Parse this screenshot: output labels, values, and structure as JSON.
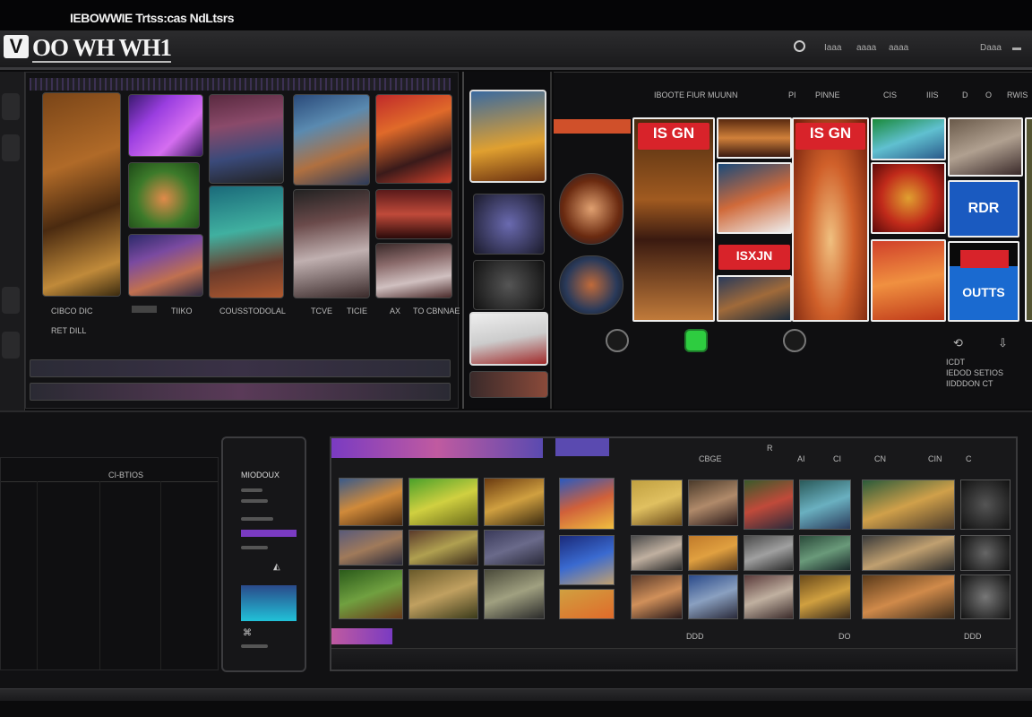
{
  "window": {
    "title": "IEBOWWIE Trtss:cas NdLtsrs"
  },
  "header": {
    "logo_badge": "V",
    "logo_text": "OO WH WH1",
    "nav": [
      "Iaaa",
      "aaaa",
      "aaaa",
      "Daaa"
    ]
  },
  "gallery": {
    "labels": [
      "CIBCO DIC",
      "TIIKO",
      "COUSSTODOLAL",
      "TCVE",
      "TICIE",
      "AX",
      "TO CBNNAE"
    ],
    "sub_label": "RET DILL"
  },
  "right_panel": {
    "top_label": "IBOOTE FIUR MUUNN",
    "top_items": [
      "PI",
      "PINNE",
      "CIS",
      "IIIS",
      "D",
      "O",
      "RWIS"
    ],
    "cards": [
      "IS GN",
      "IS GN",
      "ISXJN",
      "RDR",
      "OUTTS"
    ],
    "info_lines": [
      "ICDT",
      "IEDOD SETIOS",
      "IIDDDON CT"
    ]
  },
  "lower": {
    "side_title": "CI-BTIOS",
    "device_title": "MIODOUX",
    "toolbar_items": [
      "CBGE",
      "R",
      "AI",
      "CI",
      "CN",
      "CIN",
      "C"
    ],
    "footer_items": [
      "DDD",
      "DO",
      "DDD"
    ]
  },
  "colors": {
    "brand_red": "#d8232a",
    "accent_purple": "#7a3bc2",
    "accent_cyan": "#21c2d8",
    "green_button": "#2ecc40"
  }
}
